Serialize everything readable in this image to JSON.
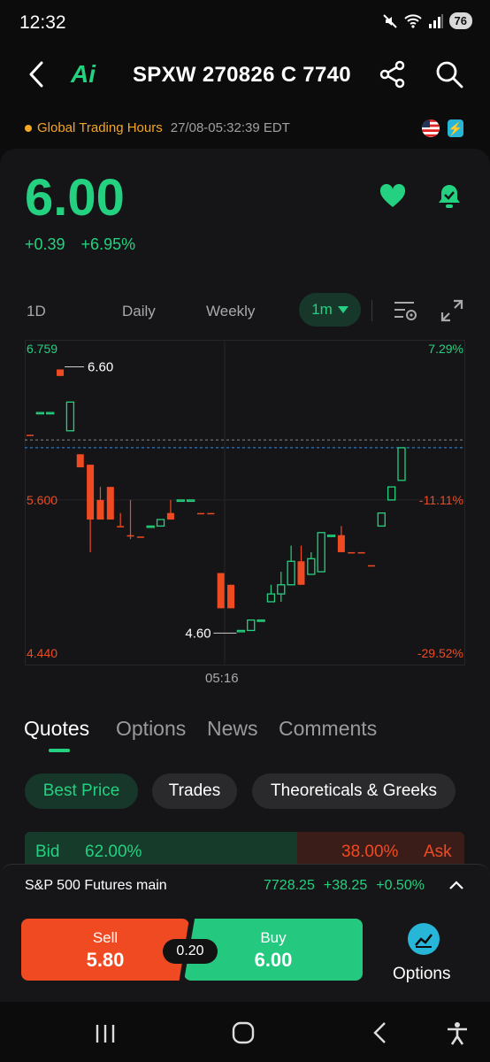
{
  "status": {
    "time": "12:32",
    "battery": "76"
  },
  "header": {
    "title": "SPXW 270826 C 7740",
    "logo_text": "Ai"
  },
  "session": {
    "label": "Global Trading Hours",
    "timestamp": "27/08-05:32:39 EDT"
  },
  "quote": {
    "price": "6.00",
    "change": "+0.39",
    "change_pct": "+6.95%"
  },
  "timeframes": {
    "items": [
      "1D",
      "Daily",
      "Weekly"
    ],
    "selected": "1m"
  },
  "chart_data": {
    "type": "candlestick",
    "y_axis_left": [
      "6.759",
      "5.600",
      "4.440"
    ],
    "y_axis_right": [
      "7.29%",
      "-11.11%",
      "-29.52%"
    ],
    "ylim": [
      4.44,
      6.759
    ],
    "reference_price": 6.0,
    "high_label": "6.60",
    "low_label": "4.60",
    "x_label": "05:16",
    "candles": [
      {
        "o": 6.1,
        "c": 6.1,
        "h": 6.1,
        "l": 6.1,
        "up": false
      },
      {
        "o": 6.27,
        "c": 6.27,
        "h": 6.27,
        "l": 6.27,
        "up": true
      },
      {
        "o": 6.27,
        "c": 6.27,
        "h": 6.27,
        "l": 6.27,
        "up": true
      },
      {
        "o": 6.55,
        "c": 6.6,
        "h": 6.6,
        "l": 6.55,
        "up": false
      },
      {
        "o": 6.13,
        "c": 6.35,
        "h": 6.35,
        "l": 6.13,
        "up": true
      },
      {
        "o": 5.95,
        "c": 5.85,
        "h": 5.95,
        "l": 5.85,
        "up": false
      },
      {
        "o": 5.87,
        "c": 5.45,
        "h": 5.87,
        "l": 5.2,
        "up": false
      },
      {
        "o": 5.6,
        "c": 5.45,
        "h": 5.7,
        "l": 5.45,
        "up": false
      },
      {
        "o": 5.7,
        "c": 5.45,
        "h": 5.7,
        "l": 5.45,
        "up": false
      },
      {
        "o": 5.4,
        "c": 5.4,
        "h": 5.5,
        "l": 5.4,
        "up": false
      },
      {
        "o": 5.33,
        "c": 5.33,
        "h": 5.6,
        "l": 5.3,
        "up": false
      },
      {
        "o": 5.32,
        "c": 5.32,
        "h": 5.32,
        "l": 5.32,
        "up": false
      },
      {
        "o": 5.4,
        "c": 5.4,
        "h": 5.4,
        "l": 5.4,
        "up": true
      },
      {
        "o": 5.4,
        "c": 5.45,
        "h": 5.45,
        "l": 5.4,
        "up": true
      },
      {
        "o": 5.45,
        "c": 5.5,
        "h": 5.6,
        "l": 5.45,
        "up": false
      },
      {
        "o": 5.6,
        "c": 5.6,
        "h": 5.6,
        "l": 5.6,
        "up": true
      },
      {
        "o": 5.6,
        "c": 5.6,
        "h": 5.6,
        "l": 5.6,
        "up": true
      },
      {
        "o": 5.5,
        "c": 5.5,
        "h": 5.5,
        "l": 5.5,
        "up": false
      },
      {
        "o": 5.5,
        "c": 5.5,
        "h": 5.5,
        "l": 5.5,
        "up": false
      },
      {
        "o": 5.04,
        "c": 4.77,
        "h": 5.04,
        "l": 4.77,
        "up": false
      },
      {
        "o": 4.95,
        "c": 4.77,
        "h": 4.95,
        "l": 4.77,
        "up": false
      },
      {
        "o": 4.6,
        "c": 4.6,
        "h": 4.6,
        "l": 4.6,
        "up": true
      },
      {
        "o": 4.6,
        "c": 4.68,
        "h": 4.68,
        "l": 4.6,
        "up": true
      },
      {
        "o": 4.68,
        "c": 4.68,
        "h": 4.68,
        "l": 4.68,
        "up": true
      },
      {
        "o": 4.82,
        "c": 4.88,
        "h": 4.95,
        "l": 4.82,
        "up": true
      },
      {
        "o": 4.88,
        "c": 4.95,
        "h": 5.05,
        "l": 4.82,
        "up": true
      },
      {
        "o": 4.95,
        "c": 5.13,
        "h": 5.25,
        "l": 4.95,
        "up": true
      },
      {
        "o": 5.13,
        "c": 4.95,
        "h": 5.25,
        "l": 4.95,
        "up": false
      },
      {
        "o": 5.03,
        "c": 5.15,
        "h": 5.2,
        "l": 5.03,
        "up": true
      },
      {
        "o": 5.05,
        "c": 5.35,
        "h": 5.35,
        "l": 5.05,
        "up": true
      },
      {
        "o": 5.33,
        "c": 5.33,
        "h": 5.33,
        "l": 5.33,
        "up": true
      },
      {
        "o": 5.33,
        "c": 5.2,
        "h": 5.4,
        "l": 5.2,
        "up": false
      },
      {
        "o": 5.2,
        "c": 5.2,
        "h": 5.2,
        "l": 5.2,
        "up": false
      },
      {
        "o": 5.2,
        "c": 5.2,
        "h": 5.2,
        "l": 5.2,
        "up": false
      },
      {
        "o": 5.1,
        "c": 5.1,
        "h": 5.1,
        "l": 5.1,
        "up": false
      },
      {
        "o": 5.4,
        "c": 5.5,
        "h": 5.5,
        "l": 5.4,
        "up": true
      },
      {
        "o": 5.6,
        "c": 5.7,
        "h": 5.7,
        "l": 5.6,
        "up": true
      },
      {
        "o": 5.75,
        "c": 6.0,
        "h": 6.0,
        "l": 5.75,
        "up": true
      }
    ]
  },
  "tabs": {
    "items": [
      "Quotes",
      "Options",
      "News",
      "Comments"
    ],
    "active": "Quotes"
  },
  "subtabs": {
    "items": [
      "Best Price",
      "Trades",
      "Theoreticals & Greeks"
    ],
    "active": "Best Price"
  },
  "bidask": {
    "bid_label": "Bid",
    "bid_pct": "62.00%",
    "ask_pct": "38.00%",
    "ask_label": "Ask",
    "bid_fraction": 0.62
  },
  "futures": {
    "name": "S&P 500 Futures main",
    "price": "7728.25",
    "change": "+38.25",
    "change_pct": "+0.50%"
  },
  "trade": {
    "sell_label": "Sell",
    "sell_price": "5.80",
    "spread": "0.20",
    "buy_label": "Buy",
    "buy_price": "6.00",
    "options_label": "Options"
  },
  "colors": {
    "green": "#24d180",
    "red": "#f04a23",
    "accent_blue": "#27b6d7",
    "orange": "#f5a623"
  }
}
